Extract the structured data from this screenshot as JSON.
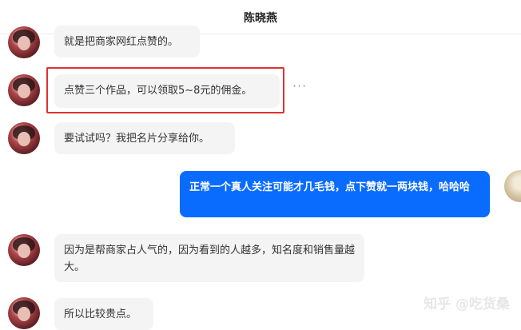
{
  "header": {
    "title": "陈晓燕"
  },
  "messages": [
    {
      "side": "left",
      "text": "就是把商家网红点赞的。"
    },
    {
      "side": "left",
      "text": "点赞三个作品，可以领取5~8元的佣金。",
      "highlighted": true
    },
    {
      "side": "left",
      "text": "要试试吗？我把名片分享给你。"
    },
    {
      "side": "right",
      "text": "正常一个真人关注可能才几毛钱，点下赞就一两块钱，哈哈哈"
    },
    {
      "side": "left",
      "text": "因为是帮商家占人气的，因为看到的人越多，知名度和销售量越大。"
    },
    {
      "side": "left",
      "text": "所以比较贵点。"
    }
  ],
  "more_options": {
    "icon": "more-horizontal-icon",
    "glyph": "···"
  },
  "watermark": {
    "text": "知乎 @吃货桑"
  },
  "colors": {
    "my_bubble": "#0a6cff",
    "their_bubble": "#f4f4f4",
    "highlight": "#e03131"
  }
}
